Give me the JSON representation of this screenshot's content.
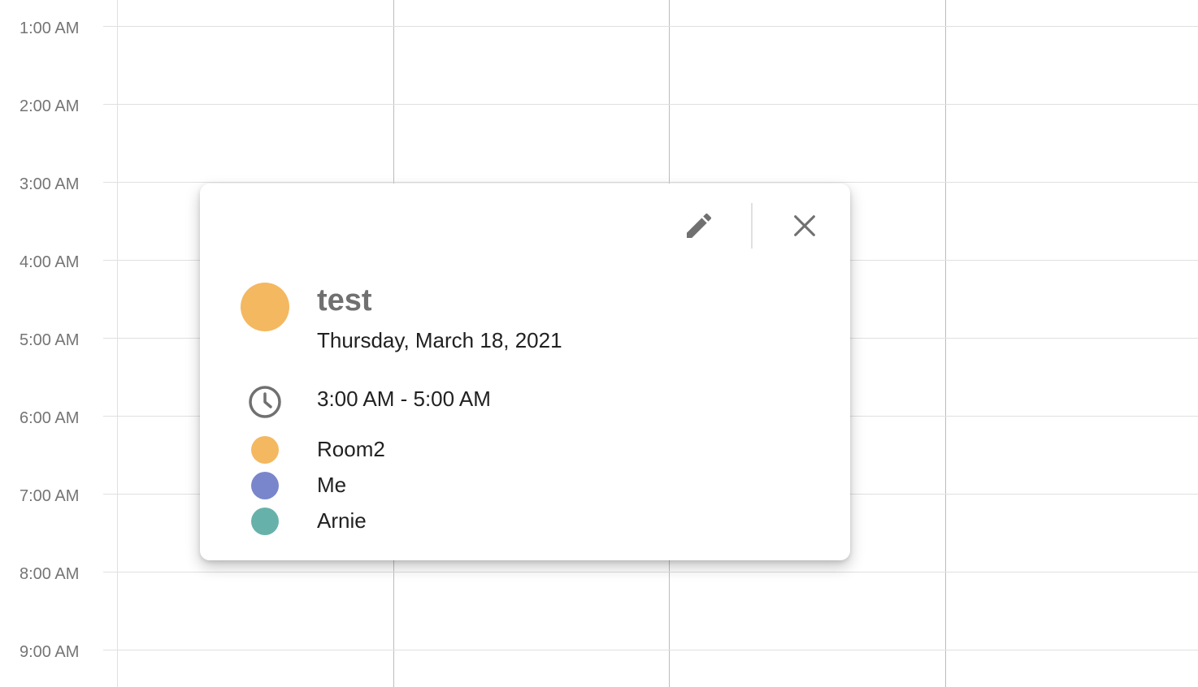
{
  "time_slots": [
    "1:00 AM",
    "2:00 AM",
    "3:00 AM",
    "4:00 AM",
    "5:00 AM",
    "6:00 AM",
    "7:00 AM",
    "8:00 AM",
    "9:00 AM"
  ],
  "popup": {
    "title": "test",
    "date": "Thursday, March 18, 2021",
    "time_range": "3:00 AM - 5:00 AM",
    "color": "#f4b860",
    "edit_icon": "pencil-icon",
    "close_icon": "close-icon",
    "time_icon": "clock-icon",
    "resources": [
      {
        "name": "Room2",
        "color": "#f4b860"
      },
      {
        "name": "Me",
        "color": "#7986cb"
      },
      {
        "name": "Arnie",
        "color": "#66b2aa"
      }
    ]
  },
  "colors": {
    "grid_line": "#e0e0e0",
    "column_line": "#bdbdbd",
    "time_label": "#757575",
    "icon": "#707070"
  }
}
